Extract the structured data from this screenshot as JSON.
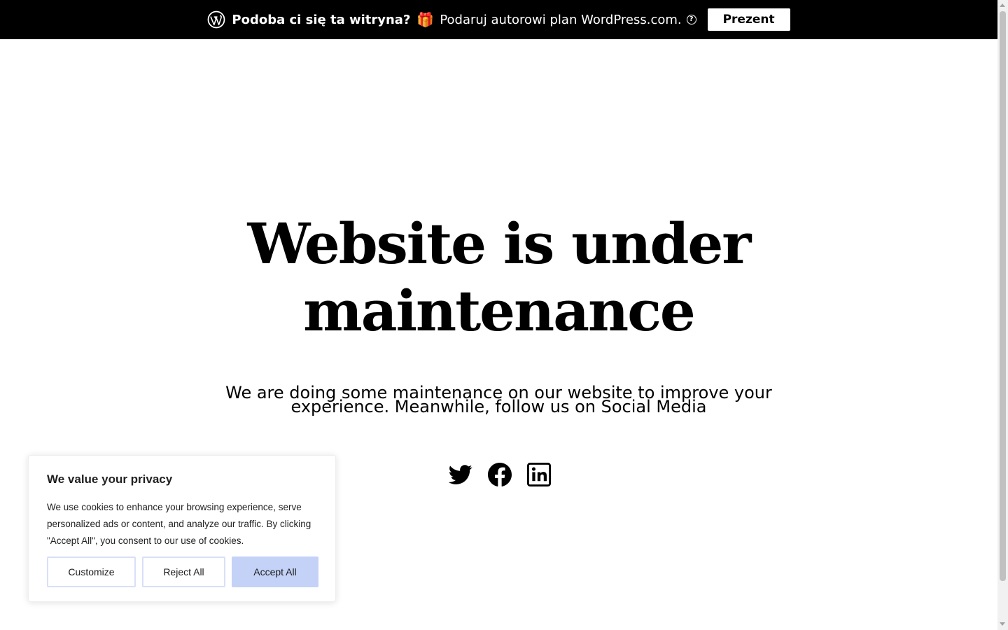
{
  "banner": {
    "question": "Podoba ci się ta witryna?",
    "gift_icon": "🎁",
    "offer": "Podaruj autorowi plan WordPress.com.",
    "help_icon": "?",
    "button_label": "Prezent"
  },
  "main": {
    "headline_line1": "Website is under",
    "headline_line2": "maintenance",
    "subtext": "We are doing some maintenance on our website to improve your experience. Meanwhile, follow us on Social Media",
    "socials": [
      "twitter-icon",
      "facebook-icon",
      "linkedin-icon"
    ]
  },
  "cookie": {
    "title": "We value your privacy",
    "text": "We use cookies to enhance your browsing experience, serve personalized ads or content, and analyze our traffic. By clicking \"Accept All\", you consent to our use of cookies.",
    "customize_label": "Customize",
    "reject_label": "Reject All",
    "accept_label": "Accept All"
  },
  "colors": {
    "banner_bg": "#000000",
    "accept_bg": "#c4d2f8",
    "button_border": "#d8e0f8"
  }
}
